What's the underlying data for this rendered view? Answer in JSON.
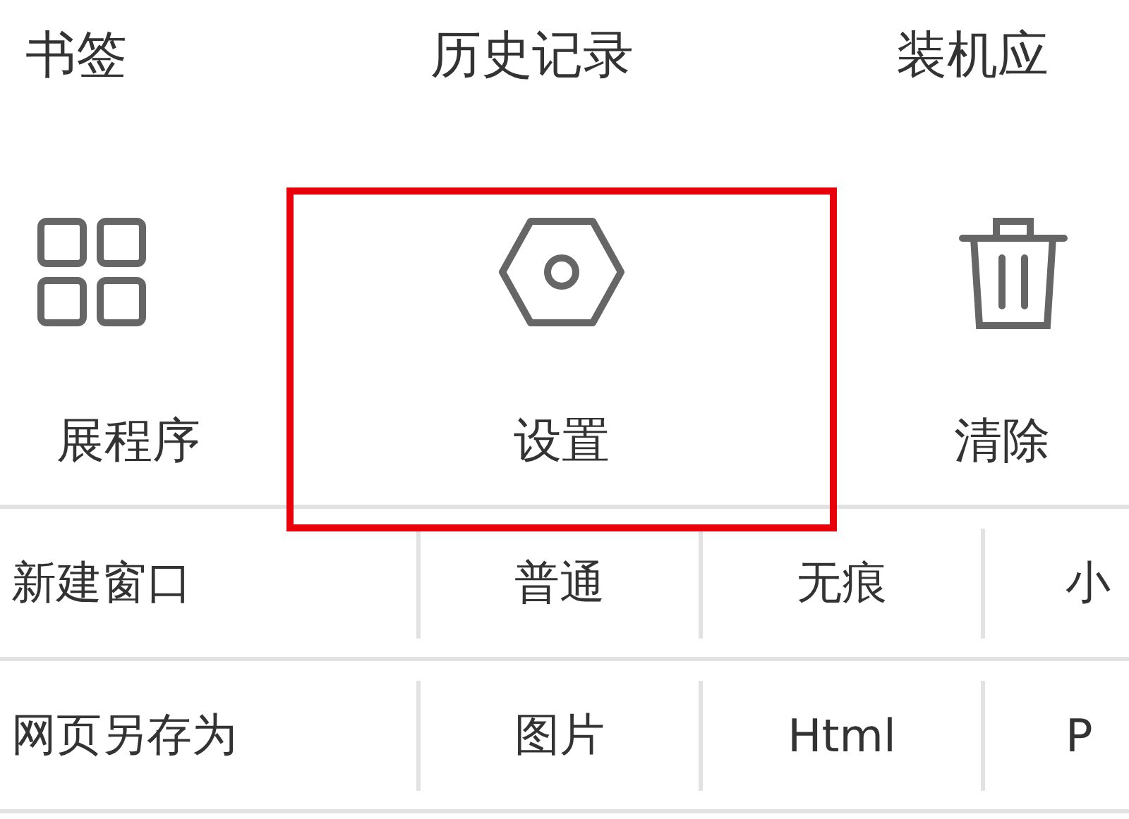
{
  "nav_links": [
    {
      "label": "书签"
    },
    {
      "label": "历史记录"
    },
    {
      "label": "装机应"
    }
  ],
  "tools": [
    {
      "label": "展程序",
      "kind": "grid",
      "highlighted": false
    },
    {
      "label": "设置",
      "kind": "settings",
      "highlighted": true
    },
    {
      "label": "清除",
      "kind": "trash",
      "highlighted": false
    }
  ],
  "rows": [
    {
      "label": "新建窗口",
      "options": [
        "普通",
        "无痕",
        "小"
      ]
    },
    {
      "label": "网页另存为",
      "options": [
        "图片",
        "Html",
        "P"
      ]
    }
  ]
}
